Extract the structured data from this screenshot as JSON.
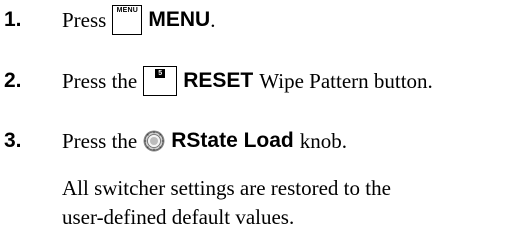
{
  "steps": [
    {
      "number": "1.",
      "prefix": "Press",
      "button_label": "MENU",
      "button_name": "MENU",
      "suffix": "."
    },
    {
      "number": "2.",
      "prefix": "Press the",
      "button_label": "5",
      "button_name": "RESET",
      "suffix": "Wipe Pattern button."
    },
    {
      "number": "3.",
      "prefix": "Press the",
      "button_icon": "knob-icon",
      "button_name": "RState Load",
      "suffix": "knob."
    }
  ],
  "result_text": {
    "line1": "All switcher settings are restored to the",
    "line2": "user-defined default values."
  }
}
